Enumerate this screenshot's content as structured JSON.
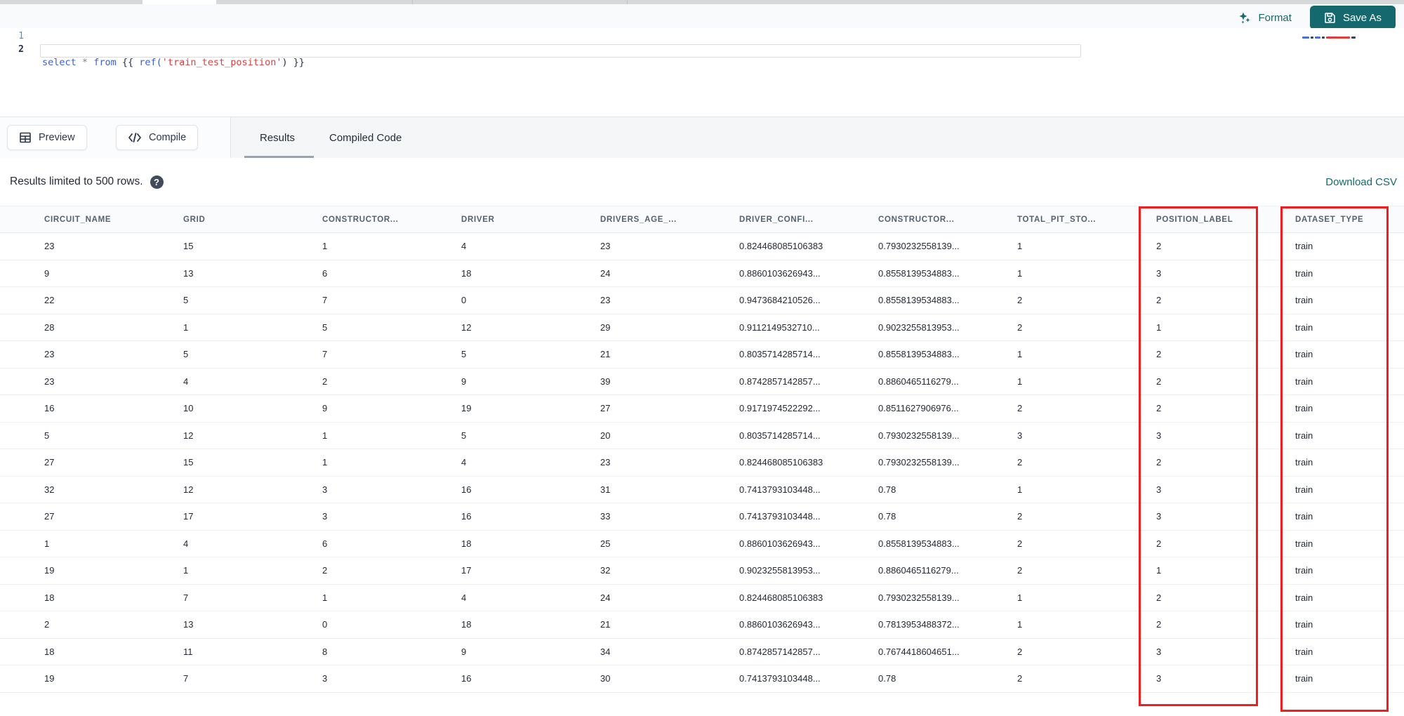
{
  "editor_toolbar": {
    "format_label": "Format",
    "save_as_label": "Save As"
  },
  "editor": {
    "line_numbers": [
      "1",
      "2"
    ],
    "code_line_1": "select * from {{ ref('train_test_position') }}",
    "code_tokens": [
      {
        "text": "select",
        "cls": "kw"
      },
      {
        "text": " ",
        "cls": "plain"
      },
      {
        "text": "*",
        "cls": "op"
      },
      {
        "text": " ",
        "cls": "plain"
      },
      {
        "text": "from",
        "cls": "kw"
      },
      {
        "text": " ",
        "cls": "plain"
      },
      {
        "text": "{{ ",
        "cls": "brace"
      },
      {
        "text": "ref(",
        "cls": "fn"
      },
      {
        "text": "'train_test_position'",
        "cls": "str"
      },
      {
        "text": ")",
        "cls": "brace"
      },
      {
        "text": " }}",
        "cls": "brace"
      }
    ]
  },
  "action_buttons": {
    "preview_label": "Preview",
    "compile_label": "Compile"
  },
  "tabs": {
    "items": [
      {
        "label": "Results",
        "active": true
      },
      {
        "label": "Compiled Code",
        "active": false
      }
    ]
  },
  "results_bar": {
    "info_text": "Results limited to 500 rows.",
    "help_glyph": "?",
    "download_label": "Download CSV"
  },
  "table": {
    "columns": [
      "CIRCUIT_NAME",
      "GRID",
      "CONSTRUCTOR...",
      "DRIVER",
      "DRIVERS_AGE_...",
      "DRIVER_CONFI...",
      "CONSTRUCTOR...",
      "TOTAL_PIT_STO...",
      "POSITION_LABEL",
      "DATASET_TYPE"
    ],
    "highlighted_columns": [
      "POSITION_LABEL",
      "DATASET_TYPE"
    ],
    "rows": [
      [
        "23",
        "15",
        "1",
        "4",
        "23",
        "0.824468085106383",
        "0.7930232558139...",
        "1",
        "2",
        "train"
      ],
      [
        "9",
        "13",
        "6",
        "18",
        "24",
        "0.8860103626943...",
        "0.8558139534883...",
        "1",
        "3",
        "train"
      ],
      [
        "22",
        "5",
        "7",
        "0",
        "23",
        "0.9473684210526...",
        "0.8558139534883...",
        "2",
        "2",
        "train"
      ],
      [
        "28",
        "1",
        "5",
        "12",
        "29",
        "0.9112149532710...",
        "0.9023255813953...",
        "2",
        "1",
        "train"
      ],
      [
        "23",
        "5",
        "7",
        "5",
        "21",
        "0.8035714285714...",
        "0.8558139534883...",
        "1",
        "2",
        "train"
      ],
      [
        "23",
        "4",
        "2",
        "9",
        "39",
        "0.8742857142857...",
        "0.8860465116279...",
        "1",
        "2",
        "train"
      ],
      [
        "16",
        "10",
        "9",
        "19",
        "27",
        "0.9171974522292...",
        "0.8511627906976...",
        "2",
        "2",
        "train"
      ],
      [
        "5",
        "12",
        "1",
        "5",
        "20",
        "0.8035714285714...",
        "0.7930232558139...",
        "3",
        "3",
        "train"
      ],
      [
        "27",
        "15",
        "1",
        "4",
        "23",
        "0.824468085106383",
        "0.7930232558139...",
        "2",
        "2",
        "train"
      ],
      [
        "32",
        "12",
        "3",
        "16",
        "31",
        "0.7413793103448...",
        "0.78",
        "1",
        "3",
        "train"
      ],
      [
        "27",
        "17",
        "3",
        "16",
        "33",
        "0.7413793103448...",
        "0.78",
        "2",
        "3",
        "train"
      ],
      [
        "1",
        "4",
        "6",
        "18",
        "25",
        "0.8860103626943...",
        "0.8558139534883...",
        "2",
        "2",
        "train"
      ],
      [
        "19",
        "1",
        "2",
        "17",
        "32",
        "0.9023255813953...",
        "0.8860465116279...",
        "2",
        "1",
        "train"
      ],
      [
        "18",
        "7",
        "1",
        "4",
        "24",
        "0.824468085106383",
        "0.7930232558139...",
        "1",
        "2",
        "train"
      ],
      [
        "2",
        "13",
        "0",
        "18",
        "21",
        "0.8860103626943...",
        "0.7813953488372...",
        "1",
        "2",
        "train"
      ],
      [
        "18",
        "11",
        "8",
        "9",
        "34",
        "0.8742857142857...",
        "0.7674418604651...",
        "2",
        "3",
        "train"
      ],
      [
        "19",
        "7",
        "3",
        "16",
        "30",
        "0.7413793103448...",
        "0.78",
        "2",
        "3",
        "train"
      ]
    ]
  },
  "colors": {
    "accent_teal": "#15696E",
    "highlight_red": "#F01E1E",
    "syntax_keyword": "#3C5FD7",
    "syntax_string": "#E03E3E",
    "tab_underline": "#9AA2AC"
  }
}
